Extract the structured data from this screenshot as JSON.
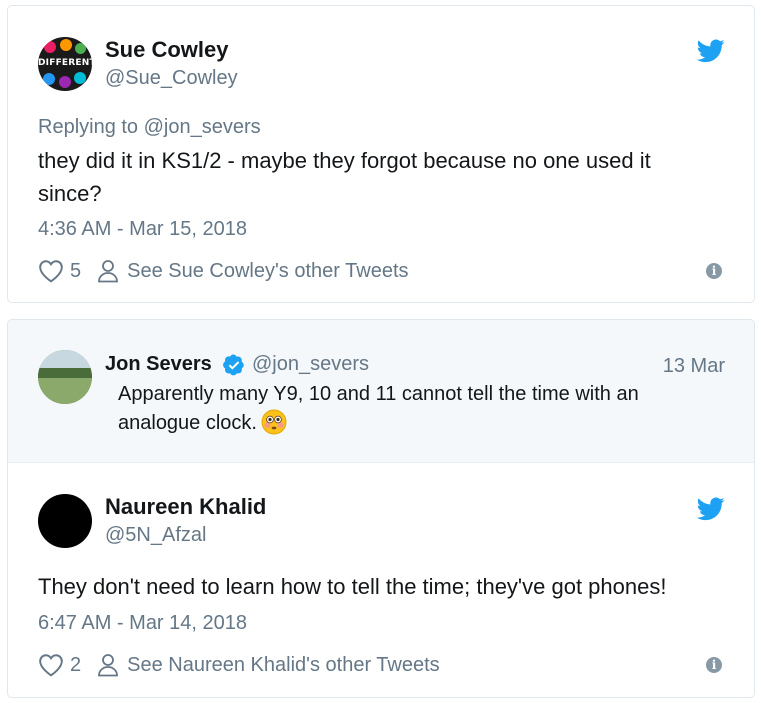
{
  "tweet1": {
    "name": "Sue Cowley",
    "handle": "@Sue_Cowley",
    "avatar_text": "DIFFERENT",
    "replying_to": "Replying to @jon_severs",
    "text_line1": "they did it in KS1/2 - maybe they forgot because no one used it",
    "text_line2": "since?",
    "timestamp": "4:36 AM - Mar 15, 2018",
    "likes": "5",
    "other_tweets": "See Sue Cowley's other Tweets",
    "info_label": "i"
  },
  "tweet2": {
    "quoted": {
      "name": "Jon Severs",
      "handle": "@jon_severs",
      "date": "13 Mar",
      "text_line1": "Apparently many Y9, 10 and 11 cannot tell the time with an",
      "text_line2": "analogue clock."
    },
    "name": "Naureen Khalid",
    "handle": "@5N_Afzal",
    "text": "They don't need to learn how to tell the time; they've got phones!",
    "timestamp": "6:47 AM - Mar 14, 2018",
    "likes": "2",
    "other_tweets": "See Naureen Khalid's other Tweets",
    "info_label": "i"
  },
  "colors": {
    "twitter_blue": "#1da1f2",
    "secondary_text": "#657786",
    "primary_text": "#14171a",
    "quoted_bg": "#f5f8fa"
  },
  "icons": [
    "twitter-bird-icon",
    "heart-icon",
    "person-icon",
    "info-icon",
    "verified-badge-icon",
    "flushed-face-emoji"
  ]
}
